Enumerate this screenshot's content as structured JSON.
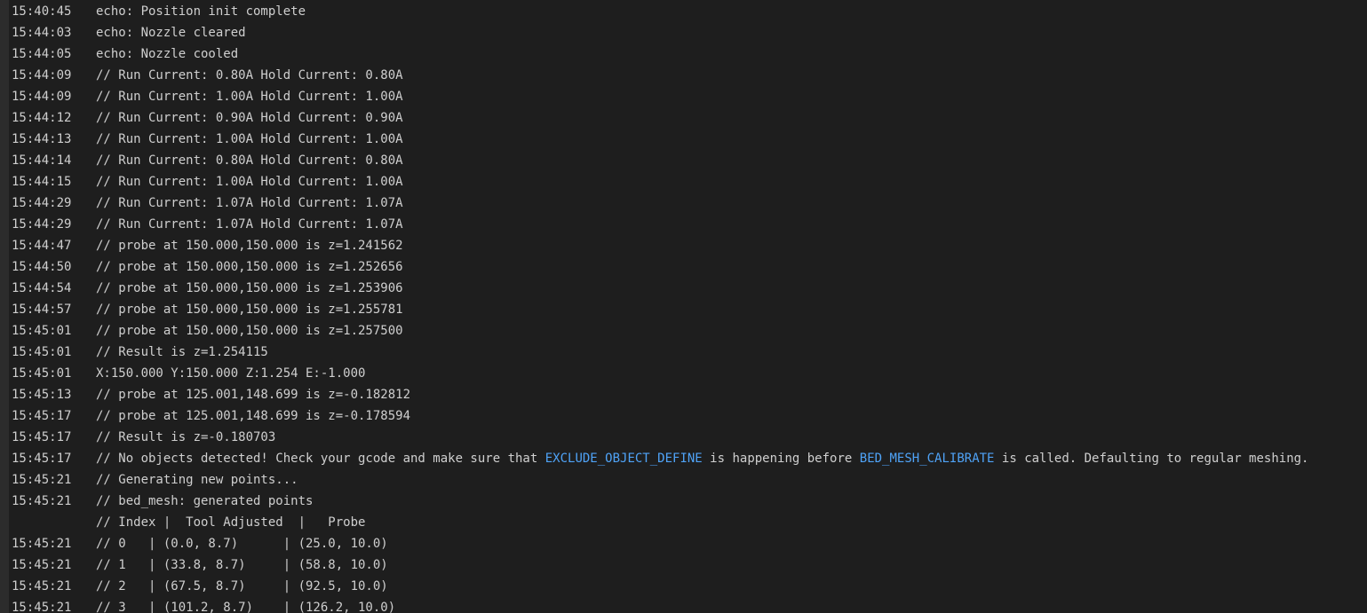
{
  "console": {
    "lines": [
      {
        "time": "15:40:45",
        "parts": [
          {
            "text": "echo: Position init complete"
          }
        ]
      },
      {
        "time": "15:44:03",
        "parts": [
          {
            "text": "echo: Nozzle cleared"
          }
        ]
      },
      {
        "time": "15:44:05",
        "parts": [
          {
            "text": "echo: Nozzle cooled"
          }
        ]
      },
      {
        "time": "15:44:09",
        "parts": [
          {
            "text": "// Run Current: 0.80A Hold Current: 0.80A"
          }
        ]
      },
      {
        "time": "15:44:09",
        "parts": [
          {
            "text": "// Run Current: 1.00A Hold Current: 1.00A"
          }
        ]
      },
      {
        "time": "15:44:12",
        "parts": [
          {
            "text": "// Run Current: 0.90A Hold Current: 0.90A"
          }
        ]
      },
      {
        "time": "15:44:13",
        "parts": [
          {
            "text": "// Run Current: 1.00A Hold Current: 1.00A"
          }
        ]
      },
      {
        "time": "15:44:14",
        "parts": [
          {
            "text": "// Run Current: 0.80A Hold Current: 0.80A"
          }
        ]
      },
      {
        "time": "15:44:15",
        "parts": [
          {
            "text": "// Run Current: 1.00A Hold Current: 1.00A"
          }
        ]
      },
      {
        "time": "15:44:29",
        "parts": [
          {
            "text": "// Run Current: 1.07A Hold Current: 1.07A"
          }
        ]
      },
      {
        "time": "15:44:29",
        "parts": [
          {
            "text": "// Run Current: 1.07A Hold Current: 1.07A"
          }
        ]
      },
      {
        "time": "15:44:47",
        "parts": [
          {
            "text": "// probe at 150.000,150.000 is z=1.241562"
          }
        ]
      },
      {
        "time": "15:44:50",
        "parts": [
          {
            "text": "// probe at 150.000,150.000 is z=1.252656"
          }
        ]
      },
      {
        "time": "15:44:54",
        "parts": [
          {
            "text": "// probe at 150.000,150.000 is z=1.253906"
          }
        ]
      },
      {
        "time": "15:44:57",
        "parts": [
          {
            "text": "// probe at 150.000,150.000 is z=1.255781"
          }
        ]
      },
      {
        "time": "15:45:01",
        "parts": [
          {
            "text": "// probe at 150.000,150.000 is z=1.257500"
          }
        ]
      },
      {
        "time": "15:45:01",
        "parts": [
          {
            "text": "// Result is z=1.254115"
          }
        ]
      },
      {
        "time": "15:45:01",
        "parts": [
          {
            "text": "X:150.000 Y:150.000 Z:1.254 E:-1.000"
          }
        ]
      },
      {
        "time": "15:45:13",
        "parts": [
          {
            "text": "// probe at 125.001,148.699 is z=-0.182812"
          }
        ]
      },
      {
        "time": "15:45:17",
        "parts": [
          {
            "text": "// probe at 125.001,148.699 is z=-0.178594"
          }
        ]
      },
      {
        "time": "15:45:17",
        "parts": [
          {
            "text": "// Result is z=-0.180703"
          }
        ]
      },
      {
        "time": "15:45:17",
        "parts": [
          {
            "text": "// No objects detected! Check your gcode and make sure that "
          },
          {
            "text": "EXCLUDE_OBJECT_DEFINE",
            "link": true
          },
          {
            "text": " is happening before "
          },
          {
            "text": "BED_MESH_CALIBRATE",
            "link": true
          },
          {
            "text": " is called. Defaulting to regular meshing."
          }
        ]
      },
      {
        "time": "15:45:21",
        "parts": [
          {
            "text": "// Generating new points..."
          }
        ]
      },
      {
        "time": "15:45:21",
        "parts": [
          {
            "text": "// bed_mesh: generated points"
          }
        ]
      },
      {
        "time": "",
        "parts": [
          {
            "text": "// Index |  Tool Adjusted  |   Probe"
          }
        ]
      },
      {
        "time": "15:45:21",
        "parts": [
          {
            "text": "// 0   | (0.0, 8.7)      | (25.0, 10.0)"
          }
        ]
      },
      {
        "time": "15:45:21",
        "parts": [
          {
            "text": "// 1   | (33.8, 8.7)     | (58.8, 10.0)"
          }
        ]
      },
      {
        "time": "15:45:21",
        "parts": [
          {
            "text": "// 2   | (67.5, 8.7)     | (92.5, 10.0)"
          }
        ]
      },
      {
        "time": "15:45:21",
        "parts": [
          {
            "text": "// 3   | (101.2, 8.7)    | (126.2, 10.0)"
          }
        ]
      }
    ]
  },
  "colors": {
    "background": "#1e1e1e",
    "gutter": "#2c2c2c",
    "text": "#cfcfcf",
    "command_link": "#4fa3f7"
  }
}
